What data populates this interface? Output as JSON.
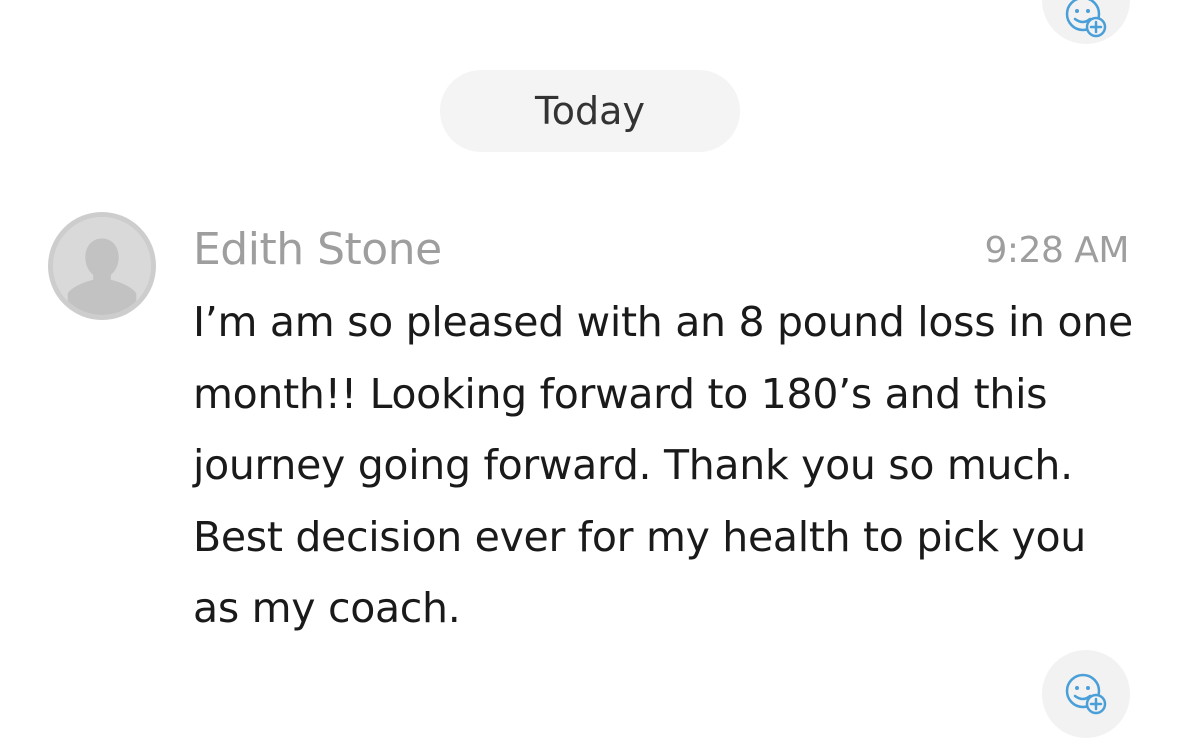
{
  "date_divider": {
    "label": "Today"
  },
  "message": {
    "sender": "Edith Stone",
    "time": "9:28 AM",
    "text": "I’m am so pleased with an 8 pound loss in one month!! Looking forward to 180’s and this journey going forward. Thank you so much. Best decision ever for my health to pick you as my coach."
  },
  "icons": {
    "reaction": "add-reaction-icon",
    "avatar": "user-avatar-placeholder-icon"
  },
  "colors": {
    "accent": "#4a9fd8",
    "muted_text": "#9e9e9e",
    "pill_bg": "#f4f4f4"
  }
}
